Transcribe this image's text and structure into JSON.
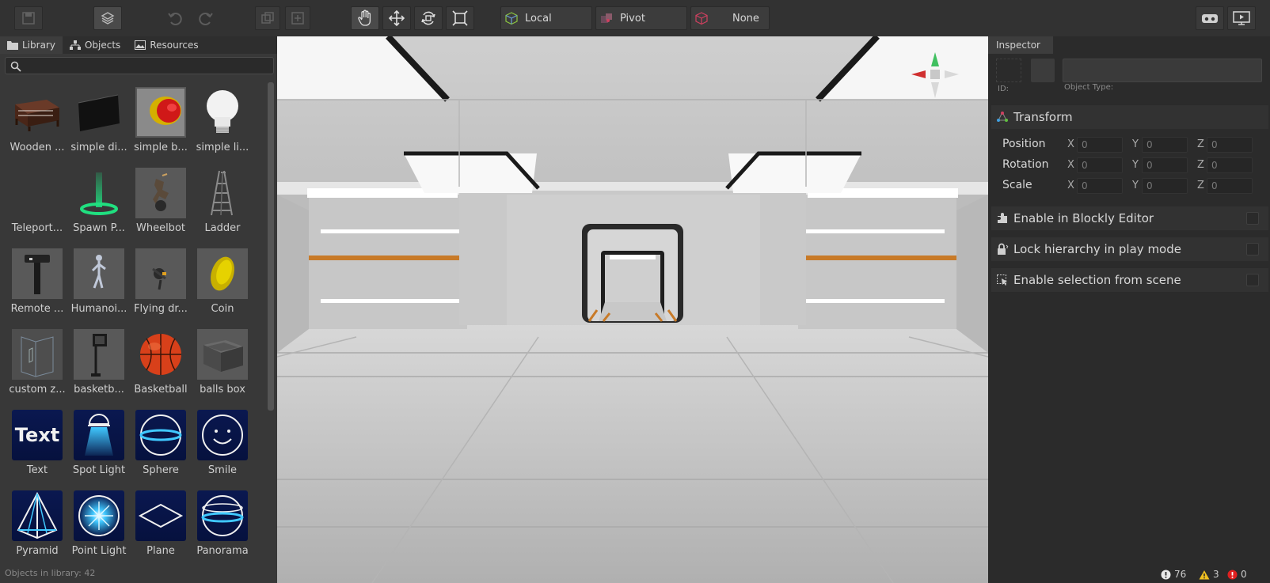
{
  "toolbar": {
    "space_label": "Local",
    "pivot_label": "Pivot",
    "snap_label": "None"
  },
  "library": {
    "tabs": [
      {
        "label": "Library",
        "icon": "folder-icon"
      },
      {
        "label": "Objects",
        "icon": "hierarchy-icon"
      },
      {
        "label": "Resources",
        "icon": "image-icon"
      }
    ],
    "search_placeholder": "",
    "items": [
      {
        "label": "Wooden ...",
        "icon": "table-model"
      },
      {
        "label": "simple di...",
        "icon": "display-model"
      },
      {
        "label": "simple b...",
        "icon": "button-model"
      },
      {
        "label": "simple li...",
        "icon": "bulb-model"
      },
      {
        "label": "Teleport...",
        "icon": "teleport-model"
      },
      {
        "label": "Spawn P...",
        "icon": "spawn-point-model"
      },
      {
        "label": "Wheelbot",
        "icon": "wheelbot-model"
      },
      {
        "label": "Ladder",
        "icon": "ladder-model"
      },
      {
        "label": "Remote ...",
        "icon": "remote-model"
      },
      {
        "label": "Humanoi...",
        "icon": "humanoid-model"
      },
      {
        "label": "Flying dr...",
        "icon": "drone-model"
      },
      {
        "label": "Coin",
        "icon": "coin-model"
      },
      {
        "label": "custom z...",
        "icon": "zone-model"
      },
      {
        "label": "basketb...",
        "icon": "hoop-model"
      },
      {
        "label": "Basketball",
        "icon": "basketball-model"
      },
      {
        "label": "balls box",
        "icon": "box-model"
      },
      {
        "label": "Text",
        "icon": "text-primitive"
      },
      {
        "label": "Spot Light",
        "icon": "spot-light-primitive"
      },
      {
        "label": "Sphere",
        "icon": "sphere-primitive"
      },
      {
        "label": "Smile",
        "icon": "smile-primitive"
      },
      {
        "label": "Pyramid",
        "icon": "pyramid-primitive"
      },
      {
        "label": "Point Light",
        "icon": "point-light-primitive"
      },
      {
        "label": "Plane",
        "icon": "plane-primitive"
      },
      {
        "label": "Panorama",
        "icon": "panorama-primitive"
      }
    ],
    "status": "Objects in library: 42"
  },
  "inspector": {
    "tab": "Inspector",
    "id_label": "ID:",
    "object_type_label": "Object Type:",
    "transform": {
      "title": "Transform",
      "rows": [
        {
          "name": "Position",
          "x": "0",
          "y": "0",
          "z": "0"
        },
        {
          "name": "Rotation",
          "x": "0",
          "y": "0",
          "z": "0"
        },
        {
          "name": "Scale",
          "x": "0",
          "y": "0",
          "z": "0"
        }
      ],
      "axes": {
        "x": "X",
        "y": "Y",
        "z": "Z"
      }
    },
    "options": [
      {
        "label": "Enable in Blockly Editor",
        "icon": "puzzle-icon",
        "checked": false
      },
      {
        "label": "Lock hierarchy in play mode",
        "icon": "lock-icon",
        "checked": false
      },
      {
        "label": "Enable selection from scene",
        "icon": "select-icon",
        "checked": false
      }
    ]
  },
  "status": {
    "info_count": "76",
    "warning_count": "3",
    "error_count": "0"
  },
  "colors": {
    "accent_blue": "#2f8fd8",
    "panel": "#383838",
    "toolbar": "#323232"
  }
}
